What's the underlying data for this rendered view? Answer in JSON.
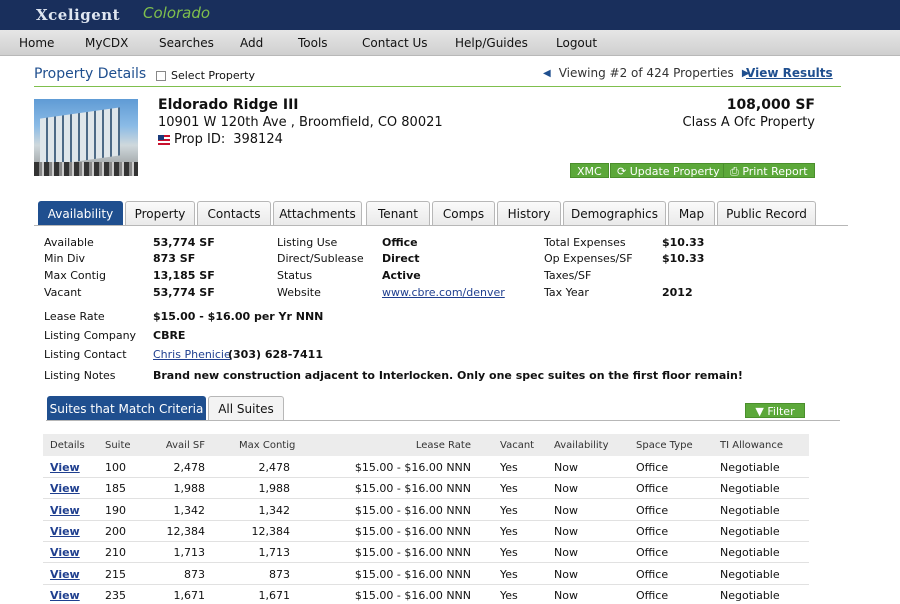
{
  "app": {
    "logo": "Xceligent",
    "region": "Colorado"
  },
  "nav": [
    "Home",
    "MyCDX",
    "Searches",
    "Add",
    "Tools",
    "Contact Us",
    "Help/Guides",
    "Logout"
  ],
  "header": {
    "title": "Property Details",
    "select_label": "Select Property",
    "viewing": "Viewing #2 of 424 Properties",
    "view_results": "View Results"
  },
  "property": {
    "name": "Eldorado Ridge III",
    "address": "10901 W 120th Ave , Broomfield, CO 80021",
    "prop_id_label": "Prop ID:",
    "prop_id": "398124",
    "size": "108,000 SF",
    "class": "Class A Ofc Property"
  },
  "buttons": {
    "xmc": "XMC",
    "update": "Update Property",
    "print": "Print Report"
  },
  "tabs": [
    "Availability",
    "Property",
    "Contacts",
    "Attachments",
    "Tenant",
    "Comps",
    "History",
    "Demographics",
    "Map",
    "Public Record"
  ],
  "availability": {
    "col1": [
      {
        "label": "Available",
        "value": "53,774 SF"
      },
      {
        "label": "Min Div",
        "value": "873 SF"
      },
      {
        "label": "Max Contig",
        "value": "13,185 SF"
      },
      {
        "label": "Vacant",
        "value": "53,774 SF"
      }
    ],
    "col2": [
      {
        "label": "Listing Use",
        "value": "Office"
      },
      {
        "label": "Direct/Sublease",
        "value": "Direct"
      },
      {
        "label": "Status",
        "value": "Active"
      },
      {
        "label": "Website",
        "value": "www.cbre.com/denver"
      }
    ],
    "col3": [
      {
        "label": "Total Expenses",
        "value": "$10.33"
      },
      {
        "label": "Op Expenses/SF",
        "value": "$10.33"
      },
      {
        "label": "Taxes/SF",
        "value": ""
      },
      {
        "label": "Tax Year",
        "value": "2012"
      }
    ],
    "lease_rate_label": "Lease Rate",
    "lease_rate": "$15.00 - $16.00  per Yr  NNN",
    "listing_company_label": "Listing Company",
    "listing_company": "CBRE",
    "listing_contact_label": "Listing Contact",
    "contact_name": "Chris Phenicie",
    "contact_phone": "(303) 628-7411",
    "listing_notes_label": "Listing Notes",
    "listing_notes": "Brand new construction adjacent to Interlocken. Only one spec suites on the first floor remain!"
  },
  "suites": {
    "tab_match": "Suites that Match Criteria",
    "tab_all": "All Suites",
    "filter": "Filter",
    "columns": [
      "Details",
      "Suite",
      "Avail SF",
      "Max Contig",
      "Lease Rate",
      "Vacant",
      "Availability",
      "Space Type",
      "TI Allowance"
    ],
    "rows": [
      [
        "View",
        "100",
        "2,478",
        "2,478",
        "$15.00 - $16.00 NNN",
        "Yes",
        "Now",
        "Office",
        "Negotiable"
      ],
      [
        "View",
        "185",
        "1,988",
        "1,988",
        "$15.00 - $16.00 NNN",
        "Yes",
        "Now",
        "Office",
        "Negotiable"
      ],
      [
        "View",
        "190",
        "1,342",
        "1,342",
        "$15.00 - $16.00 NNN",
        "Yes",
        "Now",
        "Office",
        "Negotiable"
      ],
      [
        "View",
        "200",
        "12,384",
        "12,384",
        "$15.00 - $16.00 NNN",
        "Yes",
        "Now",
        "Office",
        "Negotiable"
      ],
      [
        "View",
        "210",
        "1,713",
        "1,713",
        "$15.00 - $16.00 NNN",
        "Yes",
        "Now",
        "Office",
        "Negotiable"
      ],
      [
        "View",
        "215",
        "873",
        "873",
        "$15.00 - $16.00 NNN",
        "Yes",
        "Now",
        "Office",
        "Negotiable"
      ],
      [
        "View",
        "235",
        "1,671",
        "1,671",
        "$15.00 - $16.00 NNN",
        "Yes",
        "Now",
        "Office",
        "Negotiable"
      ]
    ]
  }
}
